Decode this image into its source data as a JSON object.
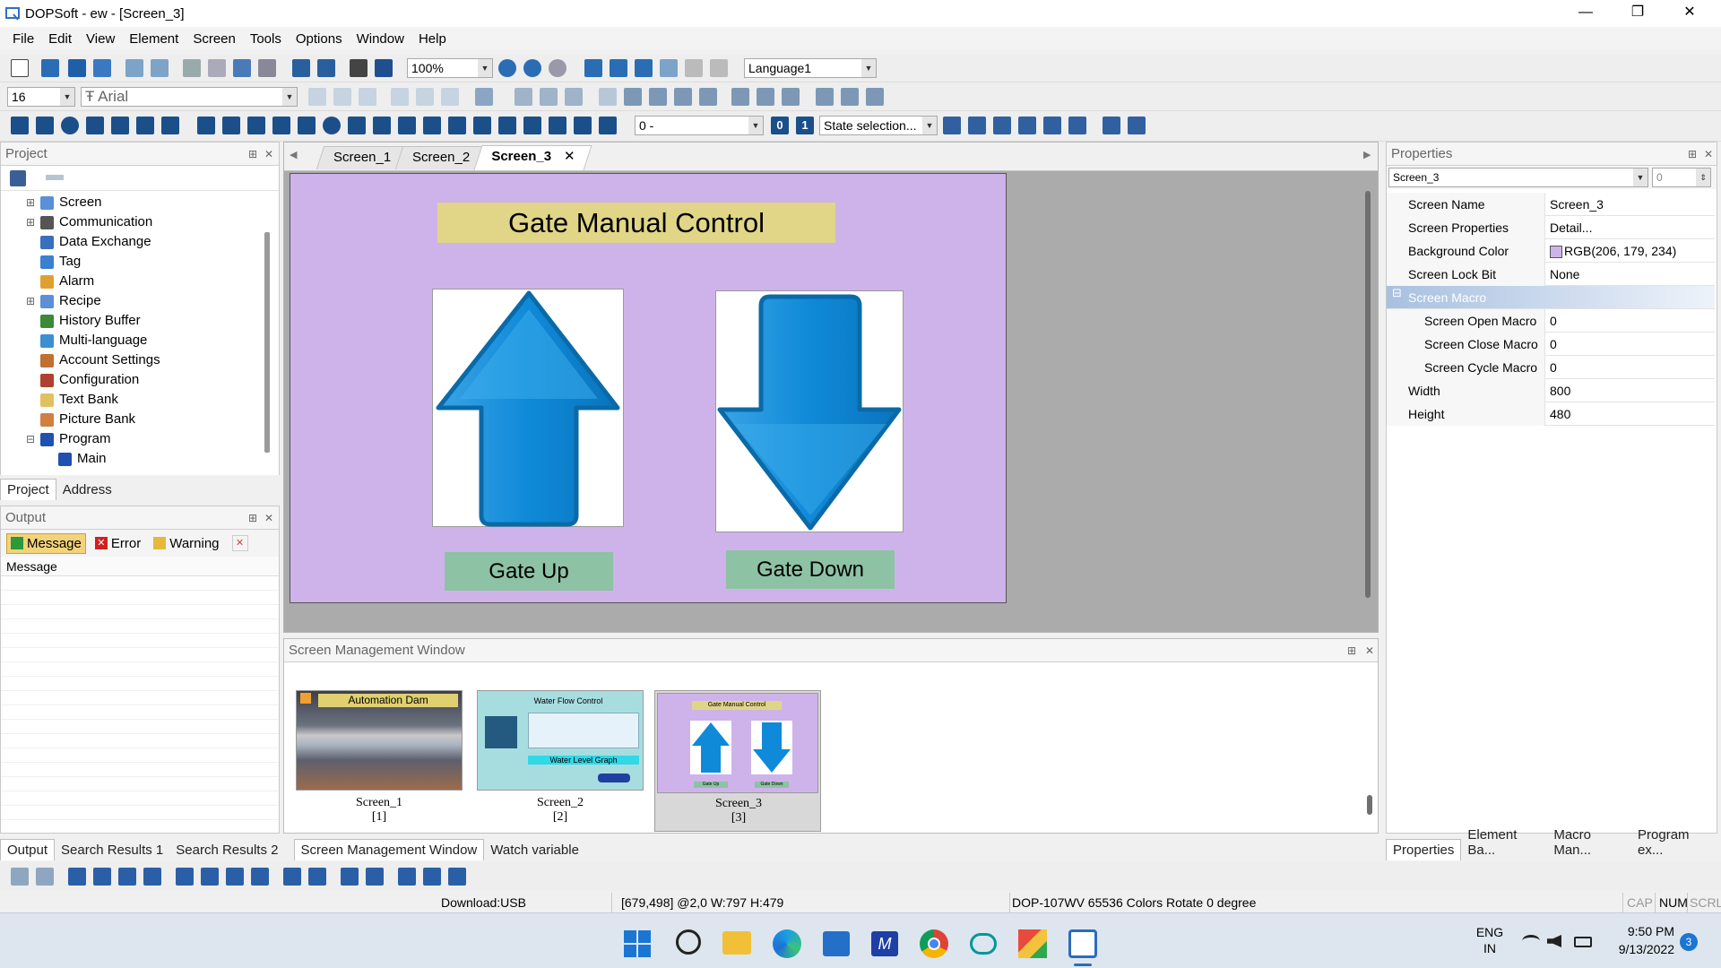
{
  "window": {
    "title": "DOPSoft - ew - [Screen_3]",
    "minimize": "—",
    "restore": "❐",
    "close": "✕"
  },
  "menu": [
    "File",
    "Edit",
    "View",
    "Element",
    "Screen",
    "Tools",
    "Options",
    "Window",
    "Help"
  ],
  "toolbar": {
    "zoom": "100%",
    "language": "Language1",
    "font_size": "16",
    "font_name": "Arial",
    "state_value": "0 -",
    "state_selection": "State selection...",
    "btn0": "0",
    "btn1": "1"
  },
  "project": {
    "title": "Project",
    "items": [
      {
        "label": "Screen",
        "icon": "screen-icon",
        "color": "#5b8fd6"
      },
      {
        "label": "Communication",
        "icon": "communication-icon",
        "color": "#555"
      },
      {
        "label": "Data Exchange",
        "icon": "data-exchange-icon",
        "color": "#3a6fbf"
      },
      {
        "label": "Tag",
        "icon": "tag-icon",
        "color": "#3a7fd0"
      },
      {
        "label": "Alarm",
        "icon": "alarm-icon",
        "color": "#e0a030"
      },
      {
        "label": "Recipe",
        "icon": "recipe-icon",
        "color": "#5b8fd6"
      },
      {
        "label": "History Buffer",
        "icon": "history-buffer-icon",
        "color": "#3a8a3a"
      },
      {
        "label": "Multi-language",
        "icon": "globe-icon",
        "color": "#3a90d0"
      },
      {
        "label": "Account Settings",
        "icon": "account-icon",
        "color": "#c07030"
      },
      {
        "label": "Configuration",
        "icon": "configuration-icon",
        "color": "#b04030"
      },
      {
        "label": "Text Bank",
        "icon": "text-bank-icon",
        "color": "#e0c060"
      },
      {
        "label": "Picture Bank",
        "icon": "picture-bank-icon",
        "color": "#d08040"
      },
      {
        "label": "Program",
        "icon": "program-icon",
        "color": "#2050b0"
      },
      {
        "label": "Main",
        "icon": "main-program-icon",
        "color": "#2050b0"
      }
    ],
    "tabs": [
      "Project",
      "Address"
    ]
  },
  "output": {
    "title": "Output",
    "filters": [
      "Message",
      "Error",
      "Warning"
    ],
    "column": "Message"
  },
  "doc_tabs": [
    "Screen_1",
    "Screen_2",
    "Screen_3"
  ],
  "canvas": {
    "title": "Gate Manual Control",
    "btn_up": "Gate Up",
    "btn_down": "Gate Down",
    "bg": "#ceb3ea"
  },
  "screen_mgmt": {
    "title": "Screen Management Window",
    "thumbs": [
      {
        "name": "Screen_1",
        "idx": "[1]",
        "caption": "Automation Dam"
      },
      {
        "name": "Screen_2",
        "idx": "[2]",
        "caption1": "Water Flow Control",
        "caption2": "Water Level Graph"
      },
      {
        "name": "Screen_3",
        "idx": "[3]",
        "caption1": "Gate Manual Control",
        "cap_up": "Gate Up",
        "cap_down": "Gate Down"
      }
    ]
  },
  "bottom_tabs": [
    "Output",
    "Search Results 1",
    "Search Results 2",
    "Screen Management Window",
    "Watch variable"
  ],
  "properties": {
    "title": "Properties",
    "selector": "Screen_3",
    "selector2": "0",
    "rows": [
      {
        "k": "Screen Name",
        "v": "Screen_3"
      },
      {
        "k": "Screen Properties",
        "v": "Detail..."
      },
      {
        "k": "Background Color",
        "v": "RGB(206, 179, 234)"
      },
      {
        "k": "Screen Lock Bit",
        "v": "None"
      },
      {
        "k": "Screen Macro",
        "v": ""
      },
      {
        "k": "Screen Open Macro",
        "v": "0"
      },
      {
        "k": "Screen Close Macro",
        "v": "0"
      },
      {
        "k": "Screen Cycle Macro",
        "v": "0"
      },
      {
        "k": "Width",
        "v": "800"
      },
      {
        "k": "Height",
        "v": "480"
      }
    ],
    "tabs": [
      "Properties",
      "Element Ba...",
      "Macro Man...",
      "Program ex..."
    ]
  },
  "status": {
    "download": "Download:USB",
    "coords": "[679,498] @2,0 W:797 H:479",
    "device": "DOP-107WV 65536 Colors Rotate 0 degree",
    "cap": "CAP",
    "num": "NUM",
    "scrl": "SCRL"
  },
  "taskbar": {
    "lang1": "ENG",
    "lang2": "IN",
    "time": "9:50 PM",
    "date": "9/13/2022",
    "badge": "3"
  }
}
